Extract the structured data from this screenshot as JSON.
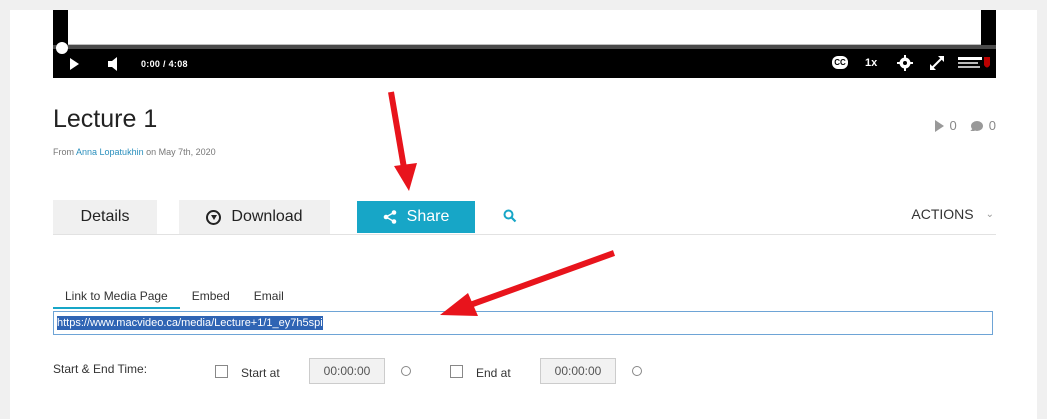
{
  "player": {
    "time": "0:00 / 4:08",
    "cc": "CC",
    "speed": "1x"
  },
  "media": {
    "title": "Lecture 1",
    "byline_prefix": "From",
    "author": "Anna Lopatukhin",
    "byline_suffix": "on May 7th, 2020",
    "plays": "0",
    "comments": "0"
  },
  "tabs": {
    "details": "Details",
    "download": "Download",
    "share": "Share",
    "actions": "ACTIONS"
  },
  "share": {
    "subtabs": [
      "Link to Media Page",
      "Embed",
      "Email"
    ],
    "link": "https://www.macvideo.ca/media/Lecture+1/1_ey7h5spi",
    "times_label": "Start & End Time:",
    "start_label": "Start at",
    "start_value": "00:00:00",
    "end_label": "End at",
    "end_value": "00:00:00"
  },
  "colors": {
    "accent": "#17a6c7",
    "annotation": "#e8141c",
    "selection": "#2f64b4"
  }
}
